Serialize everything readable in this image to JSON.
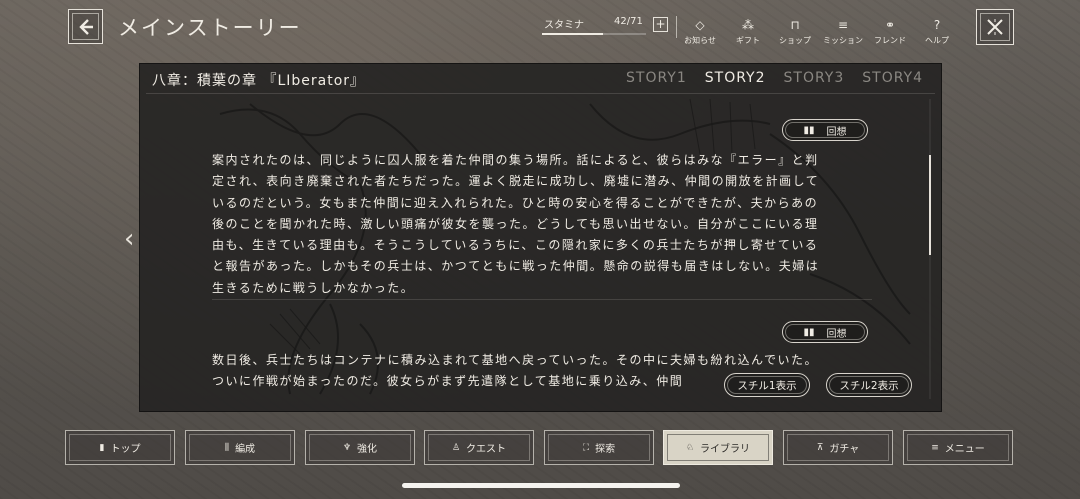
{
  "header": {
    "title": "メインストーリー",
    "stamina": {
      "label": "スタミナ",
      "value": "42/71",
      "fill_fraction": 0.59,
      "plus": "+"
    },
    "nav": [
      {
        "label": "お知らせ",
        "icon": "notice-icon",
        "glyph": "◇"
      },
      {
        "label": "ギフト",
        "icon": "gift-icon",
        "glyph": "⁂"
      },
      {
        "label": "ショップ",
        "icon": "shop-icon",
        "glyph": "⊓"
      },
      {
        "label": "ミッション",
        "icon": "mission-icon",
        "glyph": "≡"
      },
      {
        "label": "フレンド",
        "icon": "friend-icon",
        "glyph": "⚭"
      },
      {
        "label": "ヘルプ",
        "icon": "help-icon",
        "glyph": "?"
      }
    ]
  },
  "panel": {
    "chapter_title": "八章：積葉の章 『LIberator』",
    "tabs": [
      "STORY1",
      "STORY2",
      "STORY3",
      "STORY4"
    ],
    "active_tab": "STORY2",
    "recall_label": "回想",
    "paragraphs": [
      "案内されたのは、同じように囚人服を着た仲間の集う場所。話によると、彼らはみな『エラー』と判\n定され、表向き廃棄された者たちだった。運よく脱走に成功し、廃墟に潜み、仲間の開放を計画して\nいるのだという。女もまた仲間に迎え入れられた。ひと時の安心を得ることができたが、夫からあの\n後のことを聞かれた時、激しい頭痛が彼女を襲った。どうしても思い出せない。自分がここにいる理\n由も、生きている理由も。そうこうしているうちに、この隠れ家に多くの兵士たちが押し寄せている\nと報告があった。しかもその兵士は、かつてともに戦った仲間。懸命の説得も届きはしない。夫婦は\n生きるために戦うしかなかった。",
      "数日後、兵士たちはコンテナに積み込まれて基地へ戻っていった。その中に夫婦も紛れ込んでいた。\nついに作戦が始まったのだ。彼女らがまず先遣隊として基地に乗り込み、仲間"
    ],
    "still_buttons": [
      "スチル1表示",
      "スチル2表示"
    ]
  },
  "bottom_nav": [
    {
      "label": "トップ",
      "icon": "top-icon",
      "glyph": "▮"
    },
    {
      "label": "編成",
      "icon": "formation-icon",
      "glyph": "⫼"
    },
    {
      "label": "強化",
      "icon": "enhance-icon",
      "glyph": "♆"
    },
    {
      "label": "クエスト",
      "icon": "quest-icon",
      "glyph": "♙"
    },
    {
      "label": "探索",
      "icon": "explore-icon",
      "glyph": "⛶"
    },
    {
      "label": "ライブラリ",
      "icon": "library-icon",
      "glyph": "♘",
      "active": true
    },
    {
      "label": "ガチャ",
      "icon": "gacha-icon",
      "glyph": "⊼"
    },
    {
      "label": "メニュー",
      "icon": "menu-icon",
      "glyph": "≡"
    }
  ]
}
